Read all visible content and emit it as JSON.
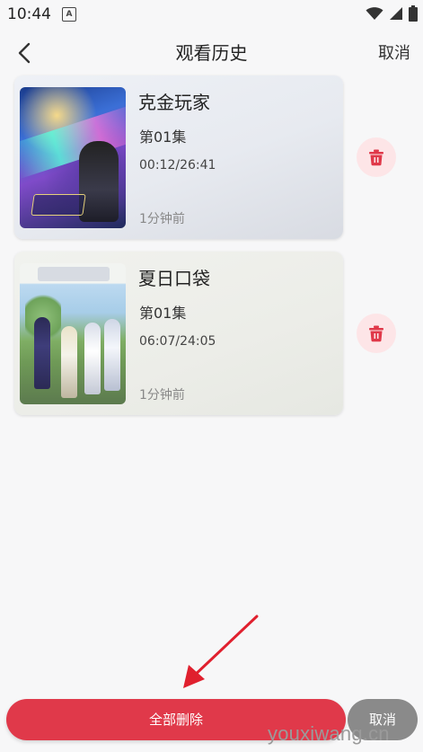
{
  "status_bar": {
    "time": "10:44",
    "app_icon_letter": "A"
  },
  "nav": {
    "title": "观看历史",
    "cancel_label": "取消"
  },
  "history": [
    {
      "title": "克金玩家",
      "episode": "第01集",
      "progress": "00:12/26:41",
      "time_ago": "1分钟前",
      "cover_icon": "cover-image-kejin-wanjia"
    },
    {
      "title": "夏日口袋",
      "episode": "第01集",
      "progress": "06:07/24:05",
      "time_ago": "1分钟前",
      "cover_icon": "cover-image-xiari-koudai"
    }
  ],
  "footer": {
    "delete_all_label": "全部删除",
    "cancel_label": "取消"
  },
  "watermark": "youxiwang.cn",
  "colors": {
    "accent_red": "#e0394a",
    "delete_bg": "#fde5e7",
    "cancel_gray": "#8a8a8a"
  }
}
